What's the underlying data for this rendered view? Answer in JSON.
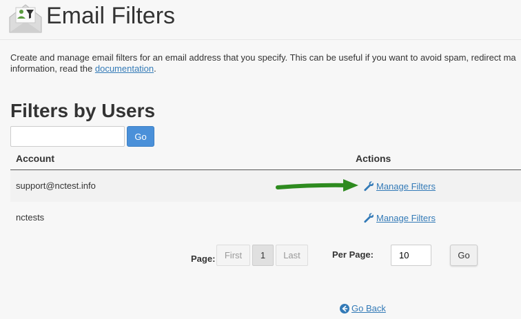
{
  "header": {
    "title": "Email Filters",
    "icon": "email-filter-icon"
  },
  "description": {
    "line1": "Create and manage email filters for an email address that you specify. This can be useful if you want to avoid spam, redirect ma",
    "line2_prefix": "information, read the ",
    "link_label": "documentation",
    "line2_suffix": "."
  },
  "section": {
    "title": "Filters by Users"
  },
  "search": {
    "value": "",
    "placeholder": "",
    "go_label": "Go"
  },
  "table": {
    "headers": {
      "account": "Account",
      "actions": "Actions"
    },
    "rows": [
      {
        "account": "support@nctest.info",
        "action_label": "Manage Filters"
      },
      {
        "account": "nctests",
        "action_label": "Manage Filters"
      }
    ]
  },
  "pagination": {
    "page_label": "Page:",
    "first_label": "First",
    "current_page": "1",
    "last_label": "Last",
    "per_page_label": "Per Page:",
    "per_page_value": "10",
    "go_label": "Go"
  },
  "footer": {
    "go_back_label": "Go Back"
  },
  "colors": {
    "link": "#337ab7",
    "primary_button": "#4a90d9",
    "annotation_arrow": "#2e8b1f"
  }
}
